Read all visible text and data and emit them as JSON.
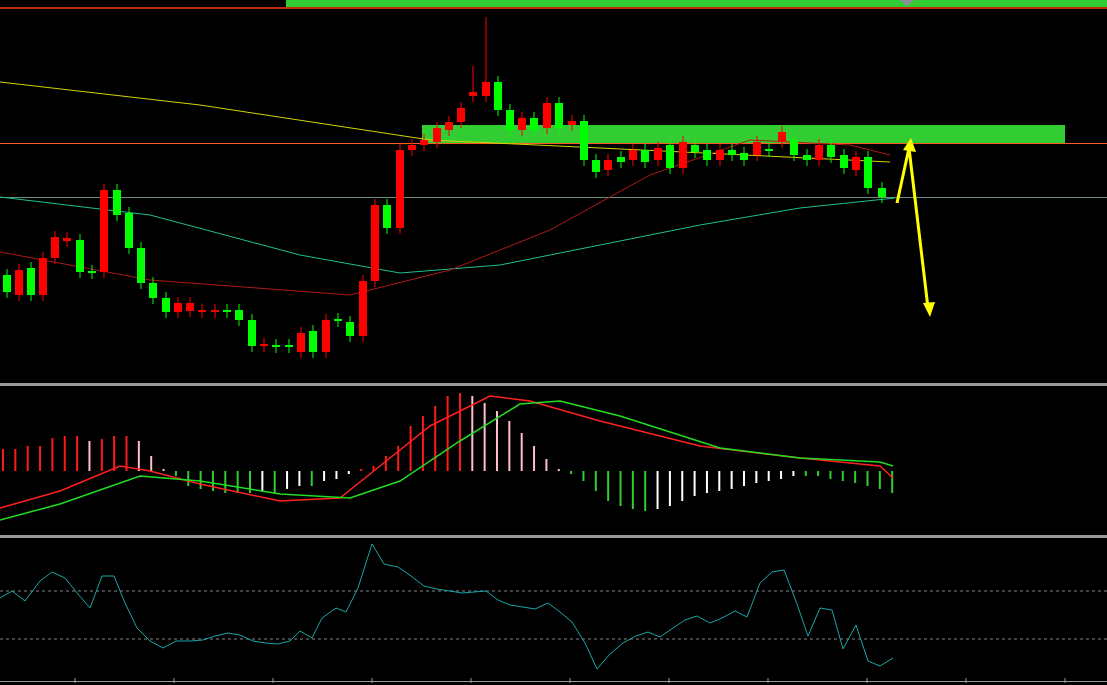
{
  "panels": [
    {
      "kind": "price"
    },
    {
      "kind": "macd"
    },
    {
      "kind": "oscillator"
    }
  ]
}
